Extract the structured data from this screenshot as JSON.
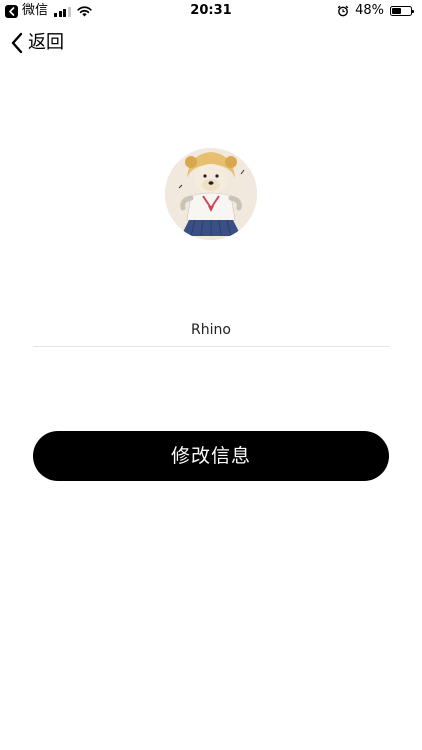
{
  "status_bar": {
    "carrier_back_label": "微信",
    "time": "20:31",
    "battery_percent_label": "48%",
    "battery_level": 0.48,
    "signal_bars_active": 3,
    "signal_bars_total": 4
  },
  "nav": {
    "back_label": "返回"
  },
  "profile": {
    "username": "Rhino"
  },
  "actions": {
    "submit_label": "修改信息"
  },
  "colors": {
    "background": "#ffffff",
    "button": "#000000",
    "button_text": "#ffffff",
    "divider": "#e4e4e4"
  }
}
